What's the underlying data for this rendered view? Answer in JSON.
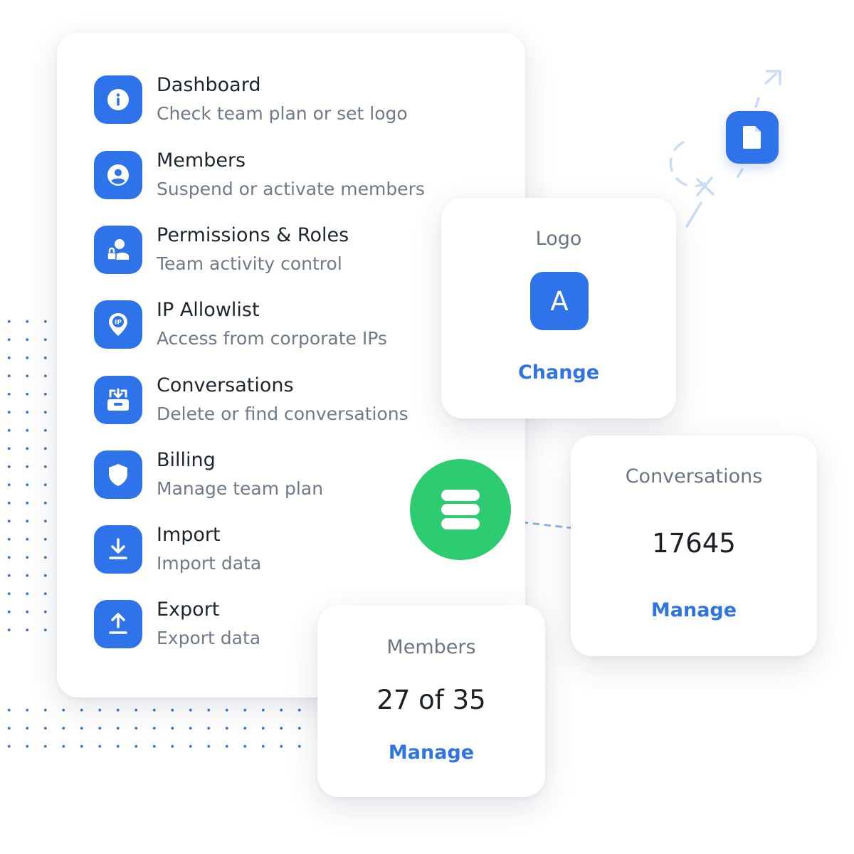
{
  "menu": {
    "items": [
      {
        "title": "Dashboard",
        "subtitle": "Check team plan or set logo",
        "icon": "info-icon"
      },
      {
        "title": "Members",
        "subtitle": "Suspend or activate members",
        "icon": "user-circle-icon"
      },
      {
        "title": "Permissions & Roles",
        "subtitle": "Team activity control",
        "icon": "user-lock-icon"
      },
      {
        "title": "IP Allowlist",
        "subtitle": "Access from corporate IPs",
        "icon": "ip-pin-icon"
      },
      {
        "title": "Conversations",
        "subtitle": "Delete or find conversations",
        "icon": "inbox-icon"
      },
      {
        "title": "Billing",
        "subtitle": "Manage team plan",
        "icon": "shield-icon"
      },
      {
        "title": "Import",
        "subtitle": "Import data",
        "icon": "download-icon"
      },
      {
        "title": "Export",
        "subtitle": "Export data",
        "icon": "upload-icon"
      }
    ]
  },
  "logo_card": {
    "label": "Logo",
    "avatar_letter": "A",
    "action": "Change"
  },
  "conversations_card": {
    "label": "Conversations",
    "value": "17645",
    "action": "Manage"
  },
  "members_card": {
    "label": "Members",
    "value": "27 of 35",
    "action": "Manage"
  },
  "colors": {
    "accent": "#2f73ea",
    "link": "#2f74e2",
    "database": "#2ecc71",
    "dots": "#2f6fe3"
  },
  "icons": {
    "hub": "database-icon",
    "floating": "document-icon"
  }
}
